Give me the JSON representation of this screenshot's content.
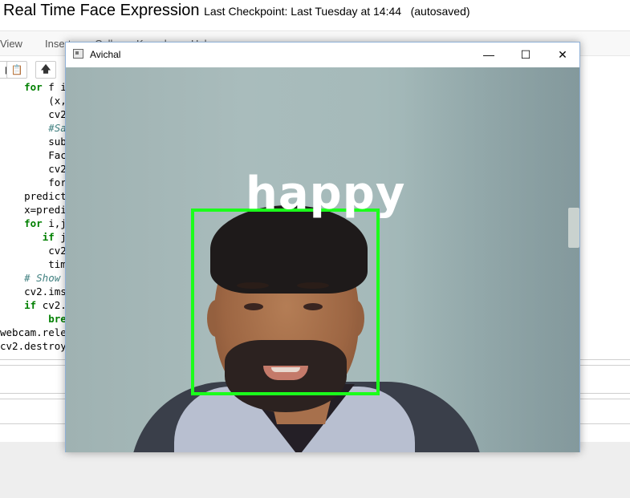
{
  "notebook": {
    "title": "Real Time Face Expression",
    "checkpoint": "Last Checkpoint: Last Tuesday at 14:44",
    "autosave": "(autosaved)",
    "menu": [
      "View",
      "Insert",
      "Cell",
      "Kernel",
      "Help"
    ],
    "code_lines": [
      {
        "pre": "    ",
        "kw": "for",
        "text": " f i"
      },
      {
        "pre": "        ",
        "kw": "",
        "text": "(x,"
      },
      {
        "pre": "        ",
        "kw": "",
        "text": "cv2"
      },
      {
        "pre": "        ",
        "kw": "",
        "text": "",
        "comment": "#Sa"
      },
      {
        "pre": "        ",
        "kw": "",
        "text": "sub"
      },
      {
        "pre": "        ",
        "kw": "",
        "text": "Fac"
      },
      {
        "pre": "        ",
        "kw": "",
        "text": "cv2"
      },
      {
        "pre": "        ",
        "kw": "",
        "text": "for"
      },
      {
        "pre": "    ",
        "kw": "",
        "text": "predict"
      },
      {
        "pre": "    ",
        "kw": "",
        "text": "x=predi"
      },
      {
        "pre": "    ",
        "kw": "for",
        "text": " i,j"
      },
      {
        "pre": "       ",
        "kw": "if",
        "text": " j"
      },
      {
        "pre": "        ",
        "kw": "",
        "text": "cv2"
      },
      {
        "pre": "        ",
        "kw": "",
        "text": "tim"
      },
      {
        "pre": "    ",
        "kw": "",
        "text": "",
        "comment": "# Show"
      },
      {
        "pre": "    ",
        "kw": "",
        "text": "cv2.ims"
      },
      {
        "pre": "    ",
        "kw": "if",
        "text": " cv2."
      },
      {
        "pre": "        ",
        "kw": "bre",
        "text": ""
      },
      {
        "pre": "",
        "kw": "",
        "text": "webcam.rele"
      },
      {
        "pre": "",
        "kw": "",
        "text": "cv2.destroy"
      }
    ]
  },
  "cv_window": {
    "title": "Avichal",
    "minimize": "—",
    "maximize": "☐",
    "close": "✕",
    "emotion": "happy",
    "box_color": "#1bff1b"
  }
}
